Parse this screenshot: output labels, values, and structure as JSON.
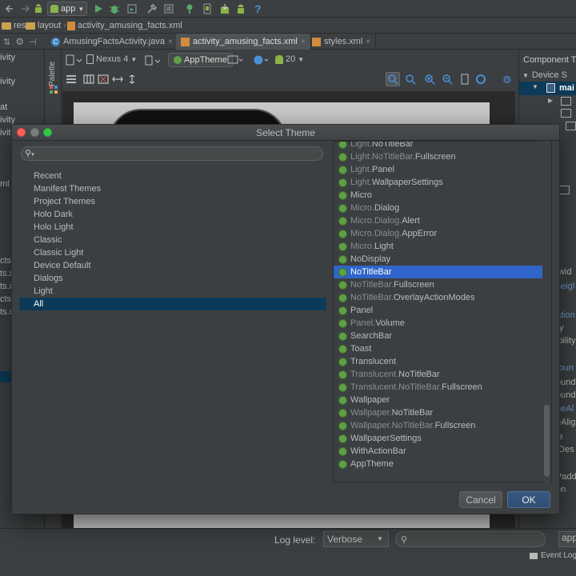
{
  "toolbar": {
    "run_config": "app"
  },
  "breadcrumb": {
    "res": "res",
    "layout": "layout",
    "file": "activity_amusing_facts.xml"
  },
  "tabs": [
    {
      "label": "AmusingFactsActivity.java"
    },
    {
      "label": "activity_amusing_facts.xml"
    },
    {
      "label": "styles.xml"
    }
  ],
  "left_panel": {
    "lines": [
      "ivity",
      "ivity",
      "at",
      "ivity",
      "ivity",
      "ml",
      "cts",
      "ts.x",
      "ts.x",
      "cts",
      "ts.x"
    ]
  },
  "designer": {
    "palette_label": "Palette",
    "device": "Nexus 4",
    "theme": "AppTheme",
    "api": "20"
  },
  "right_panel": {
    "title": "Component Tre",
    "device": "Device S",
    "main": "mai",
    "props": [
      "twid",
      "heigl",
      "ation",
      "y",
      "ibility",
      "roun",
      "ound",
      "ound",
      "neAl",
      "eAlig",
      "le",
      "tDes",
      "Padd",
      "on",
      "app"
    ]
  },
  "dialog": {
    "title": "Select Theme",
    "search_placeholder": "",
    "categories": [
      "Recent",
      "Manifest Themes",
      "Project Themes",
      "Holo Dark",
      "Holo Light",
      "Classic",
      "Classic Light",
      "Device Default",
      "Dialogs",
      "Light",
      "All"
    ],
    "selected_category": "All",
    "themes": [
      {
        "prefix": "Light.",
        "name": "NoTitleBar"
      },
      {
        "prefix": "Light.NoTitleBar.",
        "name": "Fullscreen"
      },
      {
        "prefix": "Light.",
        "name": "Panel"
      },
      {
        "prefix": "Light.",
        "name": "WallpaperSettings"
      },
      {
        "prefix": "",
        "name": "Micro"
      },
      {
        "prefix": "Micro.",
        "name": "Dialog"
      },
      {
        "prefix": "Micro.Dialog.",
        "name": "Alert"
      },
      {
        "prefix": "Micro.Dialog.",
        "name": "AppError"
      },
      {
        "prefix": "Micro.",
        "name": "Light"
      },
      {
        "prefix": "",
        "name": "NoDisplay"
      },
      {
        "prefix": "",
        "name": "NoTitleBar"
      },
      {
        "prefix": "NoTitleBar.",
        "name": "Fullscreen"
      },
      {
        "prefix": "NoTitleBar.",
        "name": "OverlayActionModes"
      },
      {
        "prefix": "",
        "name": "Panel"
      },
      {
        "prefix": "Panel.",
        "name": "Volume"
      },
      {
        "prefix": "",
        "name": "SearchBar"
      },
      {
        "prefix": "",
        "name": "Toast"
      },
      {
        "prefix": "",
        "name": "Translucent"
      },
      {
        "prefix": "Translucent.",
        "name": "NoTitleBar"
      },
      {
        "prefix": "Translucent.NoTitleBar.",
        "name": "Fullscreen"
      },
      {
        "prefix": "",
        "name": "Wallpaper"
      },
      {
        "prefix": "Wallpaper.",
        "name": "NoTitleBar"
      },
      {
        "prefix": "Wallpaper.NoTitleBar.",
        "name": "Fullscreen"
      },
      {
        "prefix": "",
        "name": "WallpaperSettings"
      },
      {
        "prefix": "",
        "name": "WithActionBar"
      },
      {
        "prefix": "",
        "name": "AppTheme"
      }
    ],
    "selected_theme_index": 10,
    "cancel_label": "Cancel",
    "ok_label": "OK"
  },
  "bottom": {
    "log_level_label": "Log level:",
    "log_level_value": "Verbose",
    "event_log": "Event Log"
  },
  "colors": {
    "background": "#3c3f41",
    "selection": "#2f65ca",
    "category_selection": "#0d3a58",
    "run_green": "#59a869"
  }
}
